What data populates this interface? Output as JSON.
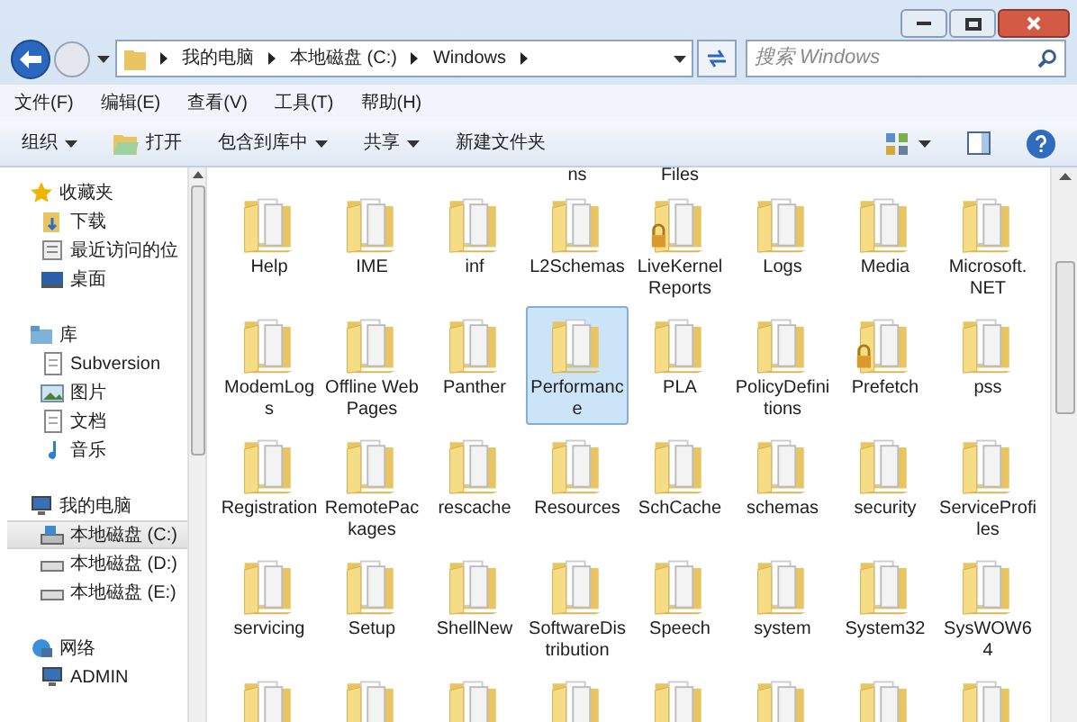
{
  "address_bar": {
    "crumbs": [
      "我的电脑",
      "本地磁盘 (C:)",
      "Windows"
    ]
  },
  "search": {
    "placeholder": "搜索 Windows"
  },
  "menu_bar": [
    "文件(F)",
    "编辑(E)",
    "查看(V)",
    "工具(T)",
    "帮助(H)"
  ],
  "toolbar": [
    {
      "label": "组织",
      "kind": "dropdown"
    },
    {
      "label": "打开",
      "kind": "open"
    },
    {
      "label": "包含到库中",
      "kind": "dropdown"
    },
    {
      "label": "共享",
      "kind": "dropdown"
    },
    {
      "label": "新建文件夹",
      "kind": "plain"
    }
  ],
  "sidebar": [
    {
      "label": "收藏夹",
      "kind": "star",
      "children": [
        {
          "label": "下载",
          "kind": "download",
          "selected": false
        },
        {
          "label": "最近访问的位",
          "kind": "recent",
          "selected": false
        },
        {
          "label": "桌面",
          "kind": "desktop",
          "selected": false
        }
      ]
    },
    {
      "label": "库",
      "kind": "library",
      "children": [
        {
          "label": "Subversion",
          "kind": "doc",
          "selected": false
        },
        {
          "label": "图片",
          "kind": "picture",
          "selected": false
        },
        {
          "label": "文档",
          "kind": "doc",
          "selected": false
        },
        {
          "label": "音乐",
          "kind": "music",
          "selected": false
        }
      ]
    },
    {
      "label": "我的电脑",
      "kind": "computer",
      "children": [
        {
          "label": "本地磁盘 (C:)",
          "kind": "sysdrive",
          "selected": true
        },
        {
          "label": "本地磁盘 (D:)",
          "kind": "drive",
          "selected": false
        },
        {
          "label": "本地磁盘 (E:)",
          "kind": "drive",
          "selected": false
        }
      ]
    },
    {
      "label": "网络",
      "kind": "network",
      "children": [
        {
          "label": "ADMIN",
          "kind": "computer",
          "selected": false
        }
      ]
    }
  ],
  "items": [
    {
      "kind": "blank"
    },
    {
      "kind": "blank"
    },
    {
      "kind": "blank"
    },
    {
      "kind": "cut_label",
      "name": "ns"
    },
    {
      "kind": "cut_label",
      "name": "Files"
    },
    {
      "kind": "blank"
    },
    {
      "kind": "blank"
    },
    {
      "kind": "blank"
    },
    {
      "kind": "folder",
      "name": "Help",
      "locked": false,
      "selected": false
    },
    {
      "kind": "folder",
      "name": "IME",
      "locked": false,
      "selected": false
    },
    {
      "kind": "folder",
      "name": "inf",
      "locked": false,
      "selected": false
    },
    {
      "kind": "folder",
      "name": "L2Schemas",
      "locked": false,
      "selected": false
    },
    {
      "kind": "folder",
      "name": "LiveKernel Reports",
      "locked": true,
      "selected": false
    },
    {
      "kind": "folder",
      "name": "Logs",
      "locked": false,
      "selected": false
    },
    {
      "kind": "folder",
      "name": "Media",
      "locked": false,
      "selected": false
    },
    {
      "kind": "folder",
      "name": "Microsoft. NET",
      "locked": false,
      "selected": false
    },
    {
      "kind": "folder",
      "name": "ModemLogs",
      "locked": false,
      "selected": false
    },
    {
      "kind": "folder",
      "name": "Offline Web Pages",
      "locked": false,
      "selected": false
    },
    {
      "kind": "folder",
      "name": "Panther",
      "locked": false,
      "selected": false
    },
    {
      "kind": "folder",
      "name": "Performance",
      "locked": false,
      "selected": true
    },
    {
      "kind": "folder",
      "name": "PLA",
      "locked": false,
      "selected": false
    },
    {
      "kind": "folder",
      "name": "PolicyDefinitions",
      "locked": false,
      "selected": false
    },
    {
      "kind": "folder",
      "name": "Prefetch",
      "locked": true,
      "selected": false
    },
    {
      "kind": "folder",
      "name": "pss",
      "locked": false,
      "selected": false
    },
    {
      "kind": "folder",
      "name": "Registration",
      "locked": false,
      "selected": false
    },
    {
      "kind": "folder",
      "name": "RemotePackages",
      "locked": false,
      "selected": false
    },
    {
      "kind": "folder",
      "name": "rescache",
      "locked": false,
      "selected": false
    },
    {
      "kind": "folder",
      "name": "Resources",
      "locked": false,
      "selected": false
    },
    {
      "kind": "folder",
      "name": "SchCache",
      "locked": false,
      "selected": false
    },
    {
      "kind": "folder",
      "name": "schemas",
      "locked": false,
      "selected": false
    },
    {
      "kind": "folder",
      "name": "security",
      "locked": false,
      "selected": false
    },
    {
      "kind": "folder",
      "name": "ServiceProfiles",
      "locked": false,
      "selected": false
    },
    {
      "kind": "folder",
      "name": "servicing",
      "locked": false,
      "selected": false
    },
    {
      "kind": "folder",
      "name": "Setup",
      "locked": false,
      "selected": false
    },
    {
      "kind": "folder",
      "name": "ShellNew",
      "locked": false,
      "selected": false
    },
    {
      "kind": "folder",
      "name": "SoftwareDistribution",
      "locked": false,
      "selected": false
    },
    {
      "kind": "folder",
      "name": "Speech",
      "locked": false,
      "selected": false
    },
    {
      "kind": "folder",
      "name": "system",
      "locked": false,
      "selected": false
    },
    {
      "kind": "folder",
      "name": "System32",
      "locked": false,
      "selected": false
    },
    {
      "kind": "folder",
      "name": "SysWOW64",
      "locked": false,
      "selected": false
    },
    {
      "kind": "folder",
      "locked": false,
      "selected": false
    },
    {
      "kind": "folder",
      "locked": false,
      "selected": false
    },
    {
      "kind": "folder",
      "locked": false,
      "selected": false
    },
    {
      "kind": "folder",
      "locked": false,
      "selected": false
    },
    {
      "kind": "folder",
      "locked": false,
      "selected": false
    },
    {
      "kind": "folder",
      "locked": false,
      "selected": false
    },
    {
      "kind": "folder",
      "locked": false,
      "selected": false
    },
    {
      "kind": "folder",
      "locked": false,
      "selected": false
    }
  ]
}
